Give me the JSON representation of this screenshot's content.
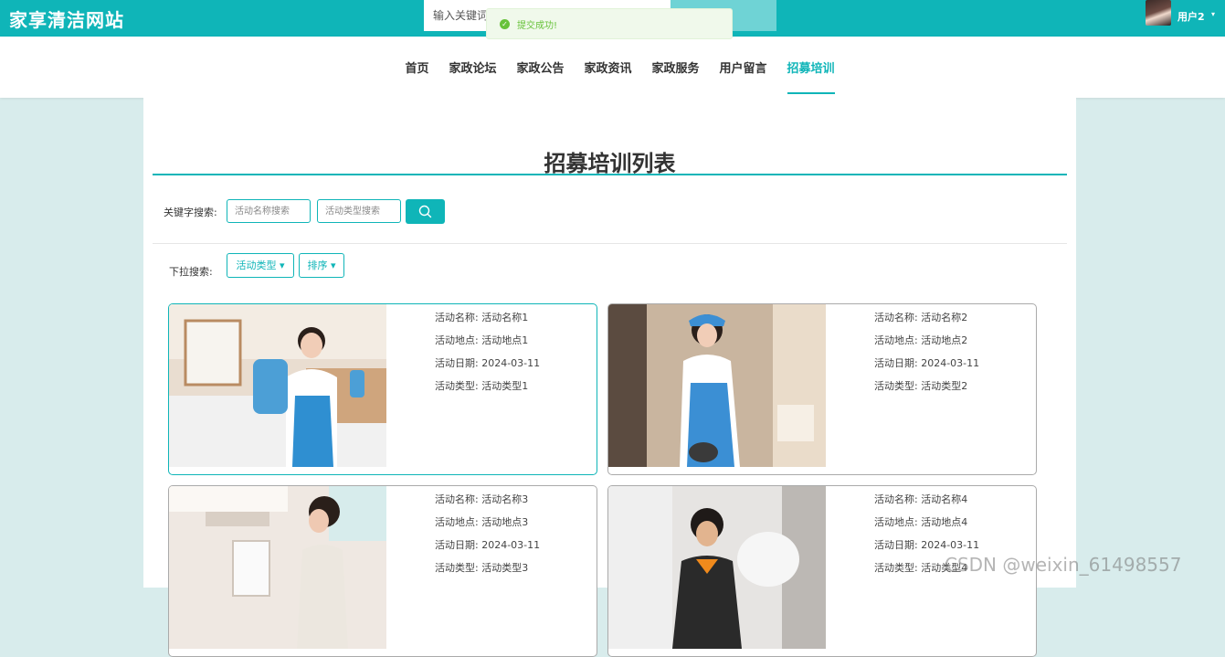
{
  "header": {
    "site_title": "家享清洁网站",
    "search_placeholder": "输入关键词",
    "toast": "提交成功!",
    "user": {
      "name": "用户2"
    }
  },
  "nav": {
    "items": [
      "首页",
      "家政论坛",
      "家政公告",
      "家政资讯",
      "家政服务",
      "用户留言",
      "招募培训"
    ],
    "active_index": 6
  },
  "page": {
    "title": "招募培训列表",
    "keyword_label": "关键字搜索:",
    "name_placeholder": "活动名称搜索",
    "type_placeholder": "活动类型搜索",
    "dropdown_label": "下拉搜索:",
    "type_dropdown": "活动类型",
    "sort_dropdown": "排序"
  },
  "cards": [
    {
      "name_label": "活动名称:",
      "name": "活动名称1",
      "place_label": "活动地点:",
      "place": "活动地点1",
      "date_label": "活动日期:",
      "date": "2024-03-11",
      "type_label": "活动类型:",
      "type": "活动类型1"
    },
    {
      "name_label": "活动名称:",
      "name": "活动名称2",
      "place_label": "活动地点:",
      "place": "活动地点2",
      "date_label": "活动日期:",
      "date": "2024-03-11",
      "type_label": "活动类型:",
      "type": "活动类型2"
    },
    {
      "name_label": "活动名称:",
      "name": "活动名称3",
      "place_label": "活动地点:",
      "place": "活动地点3",
      "date_label": "活动日期:",
      "date": "2024-03-11",
      "type_label": "活动类型:",
      "type": "活动类型3"
    },
    {
      "name_label": "活动名称:",
      "name": "活动名称4",
      "place_label": "活动地点:",
      "place": "活动地点4",
      "date_label": "活动日期:",
      "date": "2024-03-11",
      "type_label": "活动类型:",
      "type": "活动类型4"
    }
  ],
  "watermark": "CSDN @weixin_61498557",
  "colors": {
    "accent": "#0fb5b8",
    "background": "#d8ecec",
    "toast_success": "#67c23a"
  },
  "icons": {
    "search": "search-icon",
    "toast": "check-circle-icon",
    "caret": "caret-down-icon"
  }
}
